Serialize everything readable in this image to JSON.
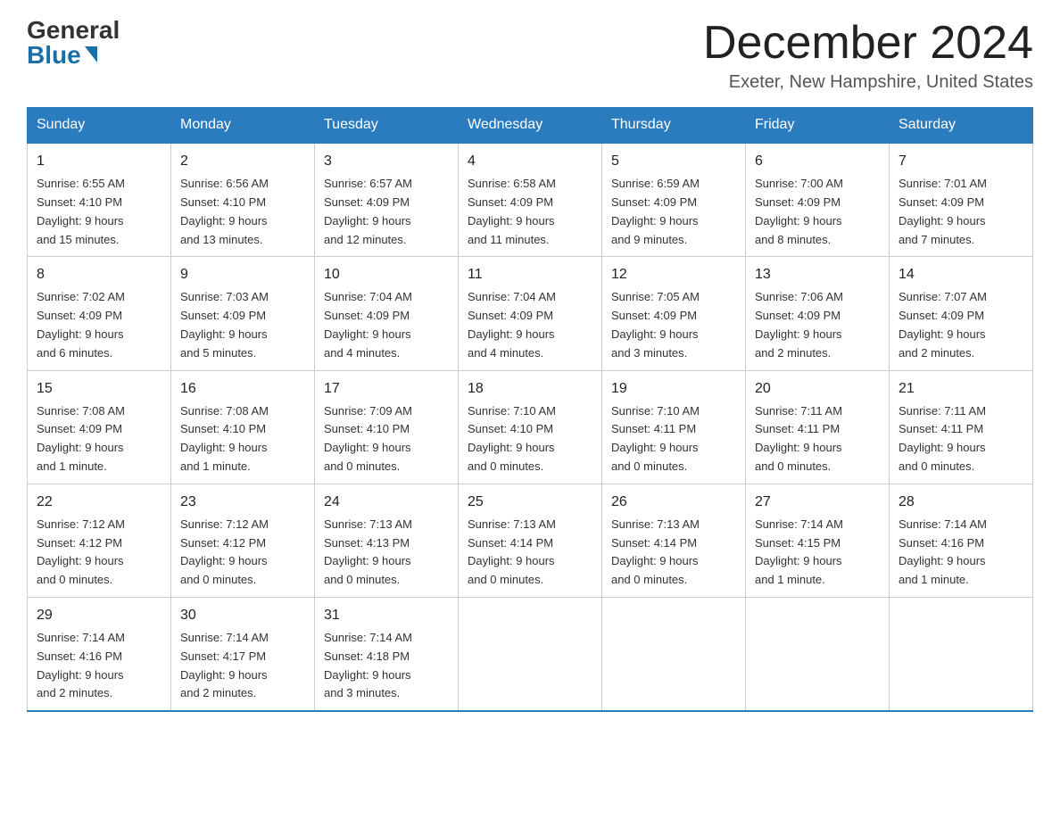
{
  "header": {
    "logo_general": "General",
    "logo_blue": "Blue",
    "month_title": "December 2024",
    "location": "Exeter, New Hampshire, United States"
  },
  "days_of_week": [
    "Sunday",
    "Monday",
    "Tuesday",
    "Wednesday",
    "Thursday",
    "Friday",
    "Saturday"
  ],
  "weeks": [
    [
      {
        "day": "1",
        "sunrise": "6:55 AM",
        "sunset": "4:10 PM",
        "daylight": "9 hours and 15 minutes."
      },
      {
        "day": "2",
        "sunrise": "6:56 AM",
        "sunset": "4:10 PM",
        "daylight": "9 hours and 13 minutes."
      },
      {
        "day": "3",
        "sunrise": "6:57 AM",
        "sunset": "4:09 PM",
        "daylight": "9 hours and 12 minutes."
      },
      {
        "day": "4",
        "sunrise": "6:58 AM",
        "sunset": "4:09 PM",
        "daylight": "9 hours and 11 minutes."
      },
      {
        "day": "5",
        "sunrise": "6:59 AM",
        "sunset": "4:09 PM",
        "daylight": "9 hours and 9 minutes."
      },
      {
        "day": "6",
        "sunrise": "7:00 AM",
        "sunset": "4:09 PM",
        "daylight": "9 hours and 8 minutes."
      },
      {
        "day": "7",
        "sunrise": "7:01 AM",
        "sunset": "4:09 PM",
        "daylight": "9 hours and 7 minutes."
      }
    ],
    [
      {
        "day": "8",
        "sunrise": "7:02 AM",
        "sunset": "4:09 PM",
        "daylight": "9 hours and 6 minutes."
      },
      {
        "day": "9",
        "sunrise": "7:03 AM",
        "sunset": "4:09 PM",
        "daylight": "9 hours and 5 minutes."
      },
      {
        "day": "10",
        "sunrise": "7:04 AM",
        "sunset": "4:09 PM",
        "daylight": "9 hours and 4 minutes."
      },
      {
        "day": "11",
        "sunrise": "7:04 AM",
        "sunset": "4:09 PM",
        "daylight": "9 hours and 4 minutes."
      },
      {
        "day": "12",
        "sunrise": "7:05 AM",
        "sunset": "4:09 PM",
        "daylight": "9 hours and 3 minutes."
      },
      {
        "day": "13",
        "sunrise": "7:06 AM",
        "sunset": "4:09 PM",
        "daylight": "9 hours and 2 minutes."
      },
      {
        "day": "14",
        "sunrise": "7:07 AM",
        "sunset": "4:09 PM",
        "daylight": "9 hours and 2 minutes."
      }
    ],
    [
      {
        "day": "15",
        "sunrise": "7:08 AM",
        "sunset": "4:09 PM",
        "daylight": "9 hours and 1 minute."
      },
      {
        "day": "16",
        "sunrise": "7:08 AM",
        "sunset": "4:10 PM",
        "daylight": "9 hours and 1 minute."
      },
      {
        "day": "17",
        "sunrise": "7:09 AM",
        "sunset": "4:10 PM",
        "daylight": "9 hours and 0 minutes."
      },
      {
        "day": "18",
        "sunrise": "7:10 AM",
        "sunset": "4:10 PM",
        "daylight": "9 hours and 0 minutes."
      },
      {
        "day": "19",
        "sunrise": "7:10 AM",
        "sunset": "4:11 PM",
        "daylight": "9 hours and 0 minutes."
      },
      {
        "day": "20",
        "sunrise": "7:11 AM",
        "sunset": "4:11 PM",
        "daylight": "9 hours and 0 minutes."
      },
      {
        "day": "21",
        "sunrise": "7:11 AM",
        "sunset": "4:11 PM",
        "daylight": "9 hours and 0 minutes."
      }
    ],
    [
      {
        "day": "22",
        "sunrise": "7:12 AM",
        "sunset": "4:12 PM",
        "daylight": "9 hours and 0 minutes."
      },
      {
        "day": "23",
        "sunrise": "7:12 AM",
        "sunset": "4:12 PM",
        "daylight": "9 hours and 0 minutes."
      },
      {
        "day": "24",
        "sunrise": "7:13 AM",
        "sunset": "4:13 PM",
        "daylight": "9 hours and 0 minutes."
      },
      {
        "day": "25",
        "sunrise": "7:13 AM",
        "sunset": "4:14 PM",
        "daylight": "9 hours and 0 minutes."
      },
      {
        "day": "26",
        "sunrise": "7:13 AM",
        "sunset": "4:14 PM",
        "daylight": "9 hours and 0 minutes."
      },
      {
        "day": "27",
        "sunrise": "7:14 AM",
        "sunset": "4:15 PM",
        "daylight": "9 hours and 1 minute."
      },
      {
        "day": "28",
        "sunrise": "7:14 AM",
        "sunset": "4:16 PM",
        "daylight": "9 hours and 1 minute."
      }
    ],
    [
      {
        "day": "29",
        "sunrise": "7:14 AM",
        "sunset": "4:16 PM",
        "daylight": "9 hours and 2 minutes."
      },
      {
        "day": "30",
        "sunrise": "7:14 AM",
        "sunset": "4:17 PM",
        "daylight": "9 hours and 2 minutes."
      },
      {
        "day": "31",
        "sunrise": "7:14 AM",
        "sunset": "4:18 PM",
        "daylight": "9 hours and 3 minutes."
      },
      null,
      null,
      null,
      null
    ]
  ],
  "labels": {
    "sunrise": "Sunrise:",
    "sunset": "Sunset:",
    "daylight": "Daylight:"
  }
}
